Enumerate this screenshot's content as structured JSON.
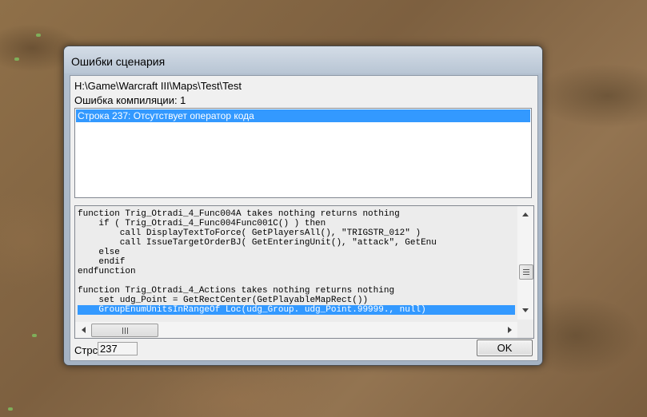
{
  "window": {
    "title": "Ошибки сценария"
  },
  "info": {
    "map_path": "H:\\Game\\Warcraft III\\Maps\\Test\\Test",
    "compile_errors": "Ошибка компиляции: 1"
  },
  "error_list": {
    "items": [
      {
        "text": "Строка 237: Отсутствует оператор кода",
        "selected": true
      }
    ]
  },
  "code": {
    "lines": [
      "function Trig_Otradi_4_Func004A takes nothing returns nothing",
      "    if ( Trig_Otradi_4_Func004Func001C() ) then",
      "        call DisplayTextToForce( GetPlayersAll(), \"TRIGSTR_012\" )",
      "        call IssueTargetOrderBJ( GetEnteringUnit(), \"attack\", GetEnu",
      "    else",
      "    endif",
      "endfunction",
      "",
      "function Trig_Otradi_4_Actions takes nothing returns nothing",
      "    set udg_Point = GetRectCenter(GetPlayableMapRect())",
      "    GroupEnumUnitsInRangeOf Loc(udg_Group. udg_Point.99999., null)"
    ],
    "selected_line_index": 10
  },
  "footer": {
    "line_label": "Стрс",
    "line_value": "237",
    "ok_label": "OK"
  },
  "icons": {
    "scroll_up": "arrow-up-icon",
    "scroll_down": "arrow-down-icon",
    "scroll_left": "arrow-left-icon",
    "scroll_right": "arrow-right-icon",
    "grip": "grip-icon"
  },
  "colors": {
    "selection": "#3399ff",
    "window_frame": "#b0bdcd",
    "desktop_terrain": "#8a6b45"
  }
}
